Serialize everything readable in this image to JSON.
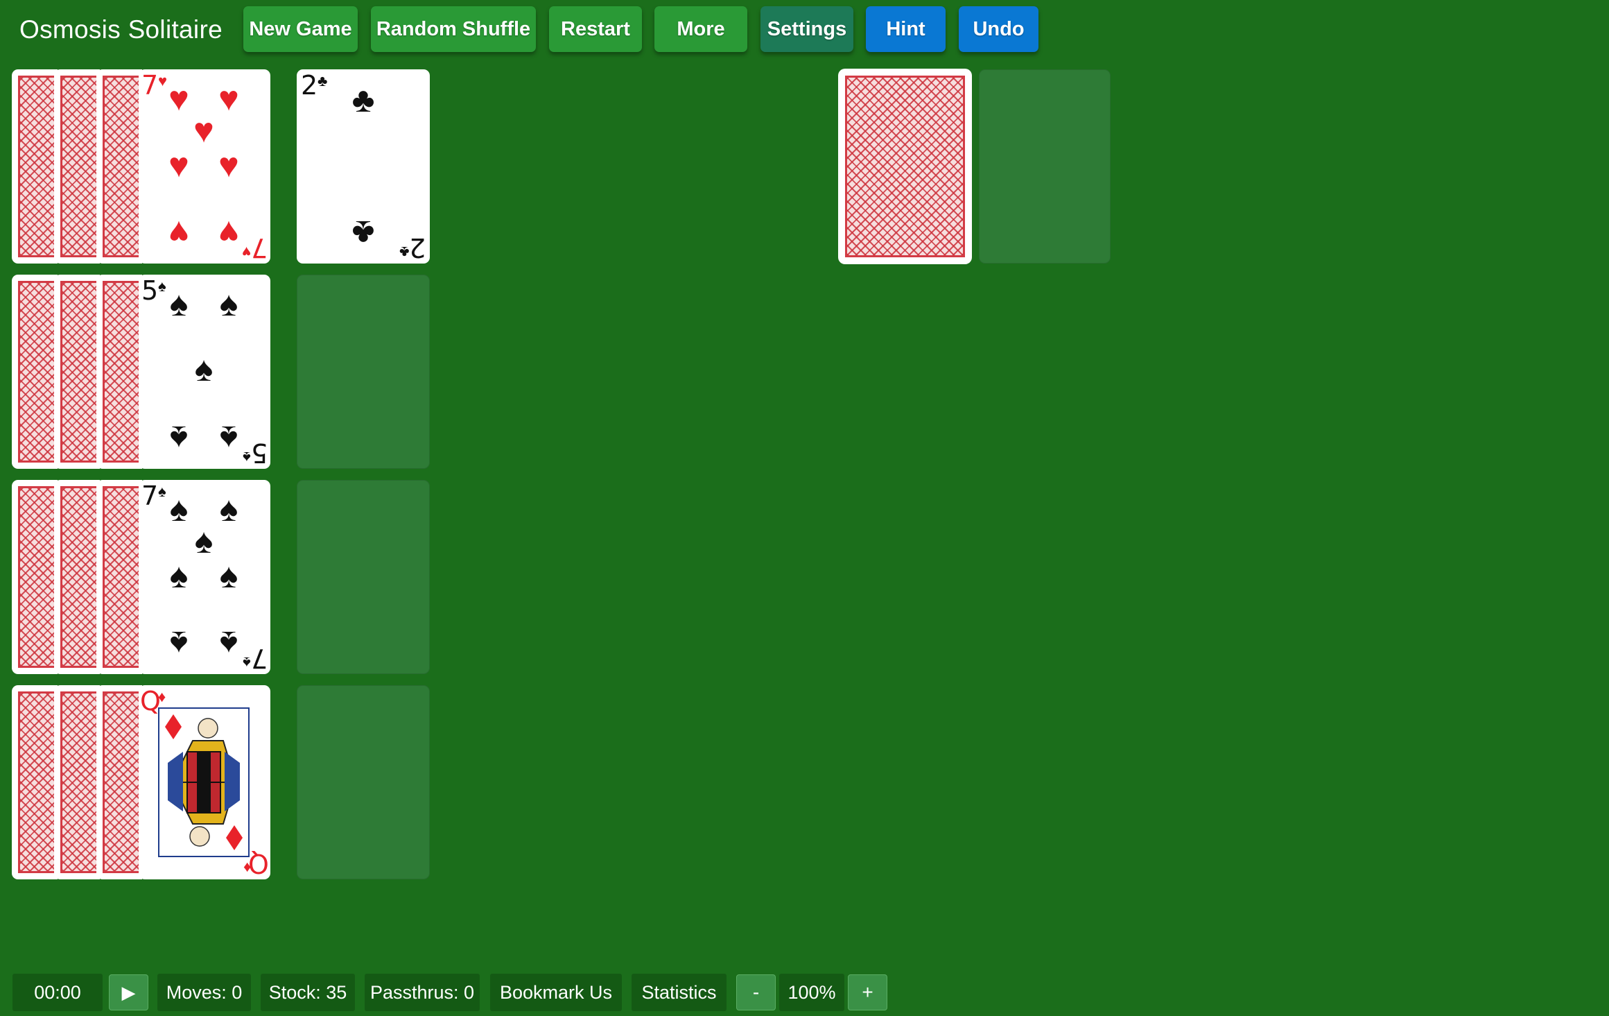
{
  "app": {
    "title": "Osmosis Solitaire"
  },
  "toolbar": {
    "new_game": "New Game",
    "random_shuffle": "Random Shuffle",
    "restart": "Restart",
    "more": "More",
    "settings": "Settings",
    "hint": "Hint",
    "undo": "Undo"
  },
  "colors": {
    "felt": "#1b6e1b",
    "button_green": "#2a9a36",
    "button_teal": "#1d7a57",
    "button_blue": "#0a78d3",
    "card_back": "#d33b45"
  },
  "reserves": [
    {
      "face_down_count": 3,
      "top_card": {
        "rank": "7",
        "suit": "♥",
        "color": "red"
      }
    },
    {
      "face_down_count": 3,
      "top_card": {
        "rank": "5",
        "suit": "♠",
        "color": "black"
      }
    },
    {
      "face_down_count": 3,
      "top_card": {
        "rank": "7",
        "suit": "♠",
        "color": "black"
      }
    },
    {
      "face_down_count": 3,
      "top_card": {
        "rank": "Q",
        "suit": "♦",
        "color": "red"
      }
    }
  ],
  "foundations": [
    {
      "card": {
        "rank": "2",
        "suit": "♣",
        "color": "black"
      }
    },
    {
      "card": null
    },
    {
      "card": null
    },
    {
      "card": null
    }
  ],
  "stock": {
    "face_down": true
  },
  "waste": {
    "card": null
  },
  "statusbar": {
    "timer": "00:00",
    "play_icon": "▶",
    "moves": "Moves: 0",
    "stock": "Stock: 35",
    "passthrus": "Passthrus: 0",
    "bookmark": "Bookmark Us",
    "statistics": "Statistics",
    "zoom_out": "-",
    "zoom_level": "100%",
    "zoom_in": "+"
  }
}
